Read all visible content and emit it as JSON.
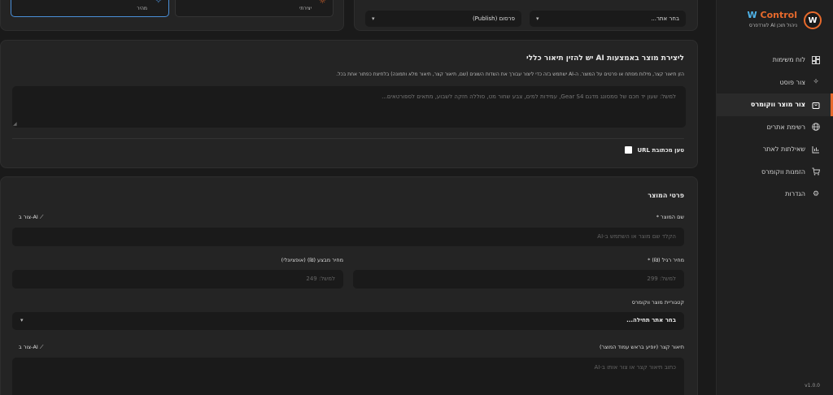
{
  "sidebar": {
    "brand_w": "W",
    "brand_control": "Control",
    "brand_sub": "ניהול תוכן AI לוורדפרס",
    "logo_letter": "W",
    "items": [
      {
        "label": "לוח משימות",
        "icon": "dashboard-icon"
      },
      {
        "label": "צור פוסט",
        "icon": "sparkles-icon"
      },
      {
        "label": "צור מוצר ווקומרס",
        "icon": "shopping-bag-icon",
        "active": true
      },
      {
        "label": "רשימת אתרים",
        "icon": "globe-icon"
      },
      {
        "label": "שאילתות לאתר",
        "icon": "chart-icon"
      },
      {
        "label": "הזמנות ווקומרס",
        "icon": "cart-icon"
      },
      {
        "label": "הגדרות",
        "icon": "gear-icon"
      }
    ],
    "version": "v1.0.0"
  },
  "top": {
    "site_select": "בחר אתר...",
    "status_select": "פרסום (Publish)",
    "type_left_label": "מהיר",
    "type_right_label": "יצירתי"
  },
  "ai": {
    "title": "ליצירת מוצר באמצעות AI יש להזין תיאור כללי",
    "desc": "הזן תיאור קצר, מילות מפתח או פרטים על המוצר. ה-AI ישתמש בזה כדי ליצור עבורך את השדות השונים (שם, תיאור קצר, תיאור מלא ותמונה) בלחיצת כפתור אחת בכל.",
    "placeholder": "למשל: שעון יד חכם של סמסונג מדגם Gear S4, עמידות למים, צבע שחור מט, סוללה חזקה לשבוע, מתאים לספורטאים...",
    "url_label": "טען מכתובת URL"
  },
  "product": {
    "section_title": "פרטי המוצר",
    "name_label": "שם המוצר *",
    "name_placeholder": "הקלד שם מוצר או השתמש ב-AI",
    "ai_create": "צור ב-AI",
    "regular_price_label": "מחיר רגיל (₪) *",
    "regular_price_placeholder": "למשל: 299",
    "sale_price_label": "מחיר מבצע (₪) (אופציונלי)",
    "sale_price_placeholder": "למשל: 249",
    "category_label": "קטגוריית מוצר ווקומרס",
    "category_value": "בחר אתר תחילה...",
    "short_desc_label": "תיאור קצר (יופיע בראש עמוד המוצר)",
    "short_desc_placeholder": "כתוב תיאור קצר או צור אותו ב-AI"
  },
  "colors": {
    "accent": "#e86a2c",
    "brand_blue": "#4fb3e8",
    "selected_border": "#4a8fd8"
  }
}
